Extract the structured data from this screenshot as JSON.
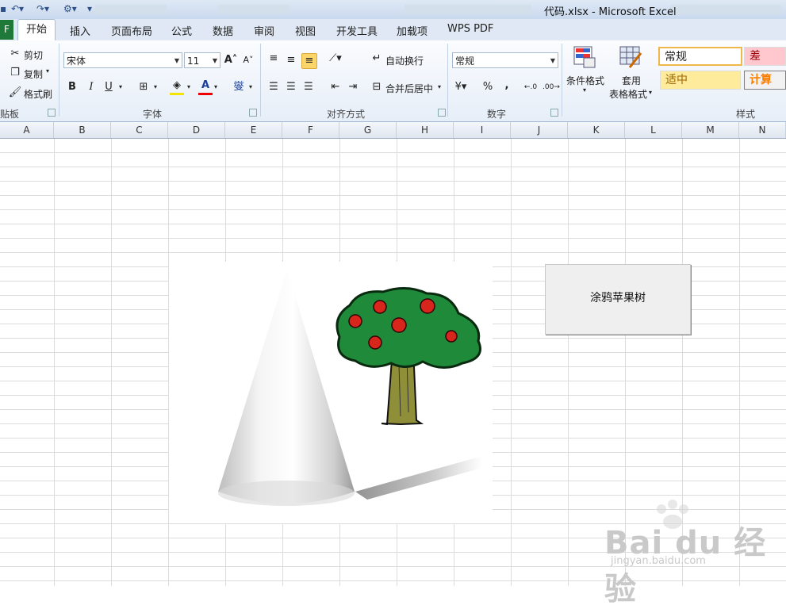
{
  "window": {
    "title": "代码.xlsx  -  Microsoft Excel"
  },
  "tabs": {
    "file": "F",
    "items": [
      "开始",
      "插入",
      "页面布局",
      "公式",
      "数据",
      "审阅",
      "视图",
      "开发工具",
      "加载项",
      "WPS PDF"
    ]
  },
  "clipboard": {
    "cut": "剪切",
    "copy": "复制",
    "format_painter": "格式刷",
    "group": "贴板"
  },
  "font": {
    "name": "宋体",
    "size": "11",
    "group": "字体",
    "bold": "B",
    "italic": "I",
    "underline": "U",
    "font_color": "A",
    "phonetic": "燮"
  },
  "alignment": {
    "wrap": "自动换行",
    "merge": "合并后居中",
    "group": "对齐方式"
  },
  "number": {
    "format": "常规",
    "percent": "%",
    "comma": ",",
    "group": "数字"
  },
  "styles": {
    "conditional": "条件格式",
    "table_fmt_1": "套用",
    "table_fmt_2": "表格格式",
    "normal": "常规",
    "bad": "差",
    "neutral": "适中",
    "calc": "计算",
    "group": "样式"
  },
  "columns": [
    "A",
    "B",
    "C",
    "D",
    "E",
    "F",
    "G",
    "H",
    "I",
    "J",
    "K",
    "L",
    "M",
    "N"
  ],
  "macro_button": {
    "label": "涂鸦苹果树"
  },
  "watermark": {
    "brand": "Bai  du 经验",
    "url": "jingyan.baidu.com"
  },
  "colors": {
    "file_tab": "#1f7a3a",
    "tree_leaves": "#1f8a3a",
    "apple": "#d9261c",
    "trunk": "#8f8f3a"
  }
}
